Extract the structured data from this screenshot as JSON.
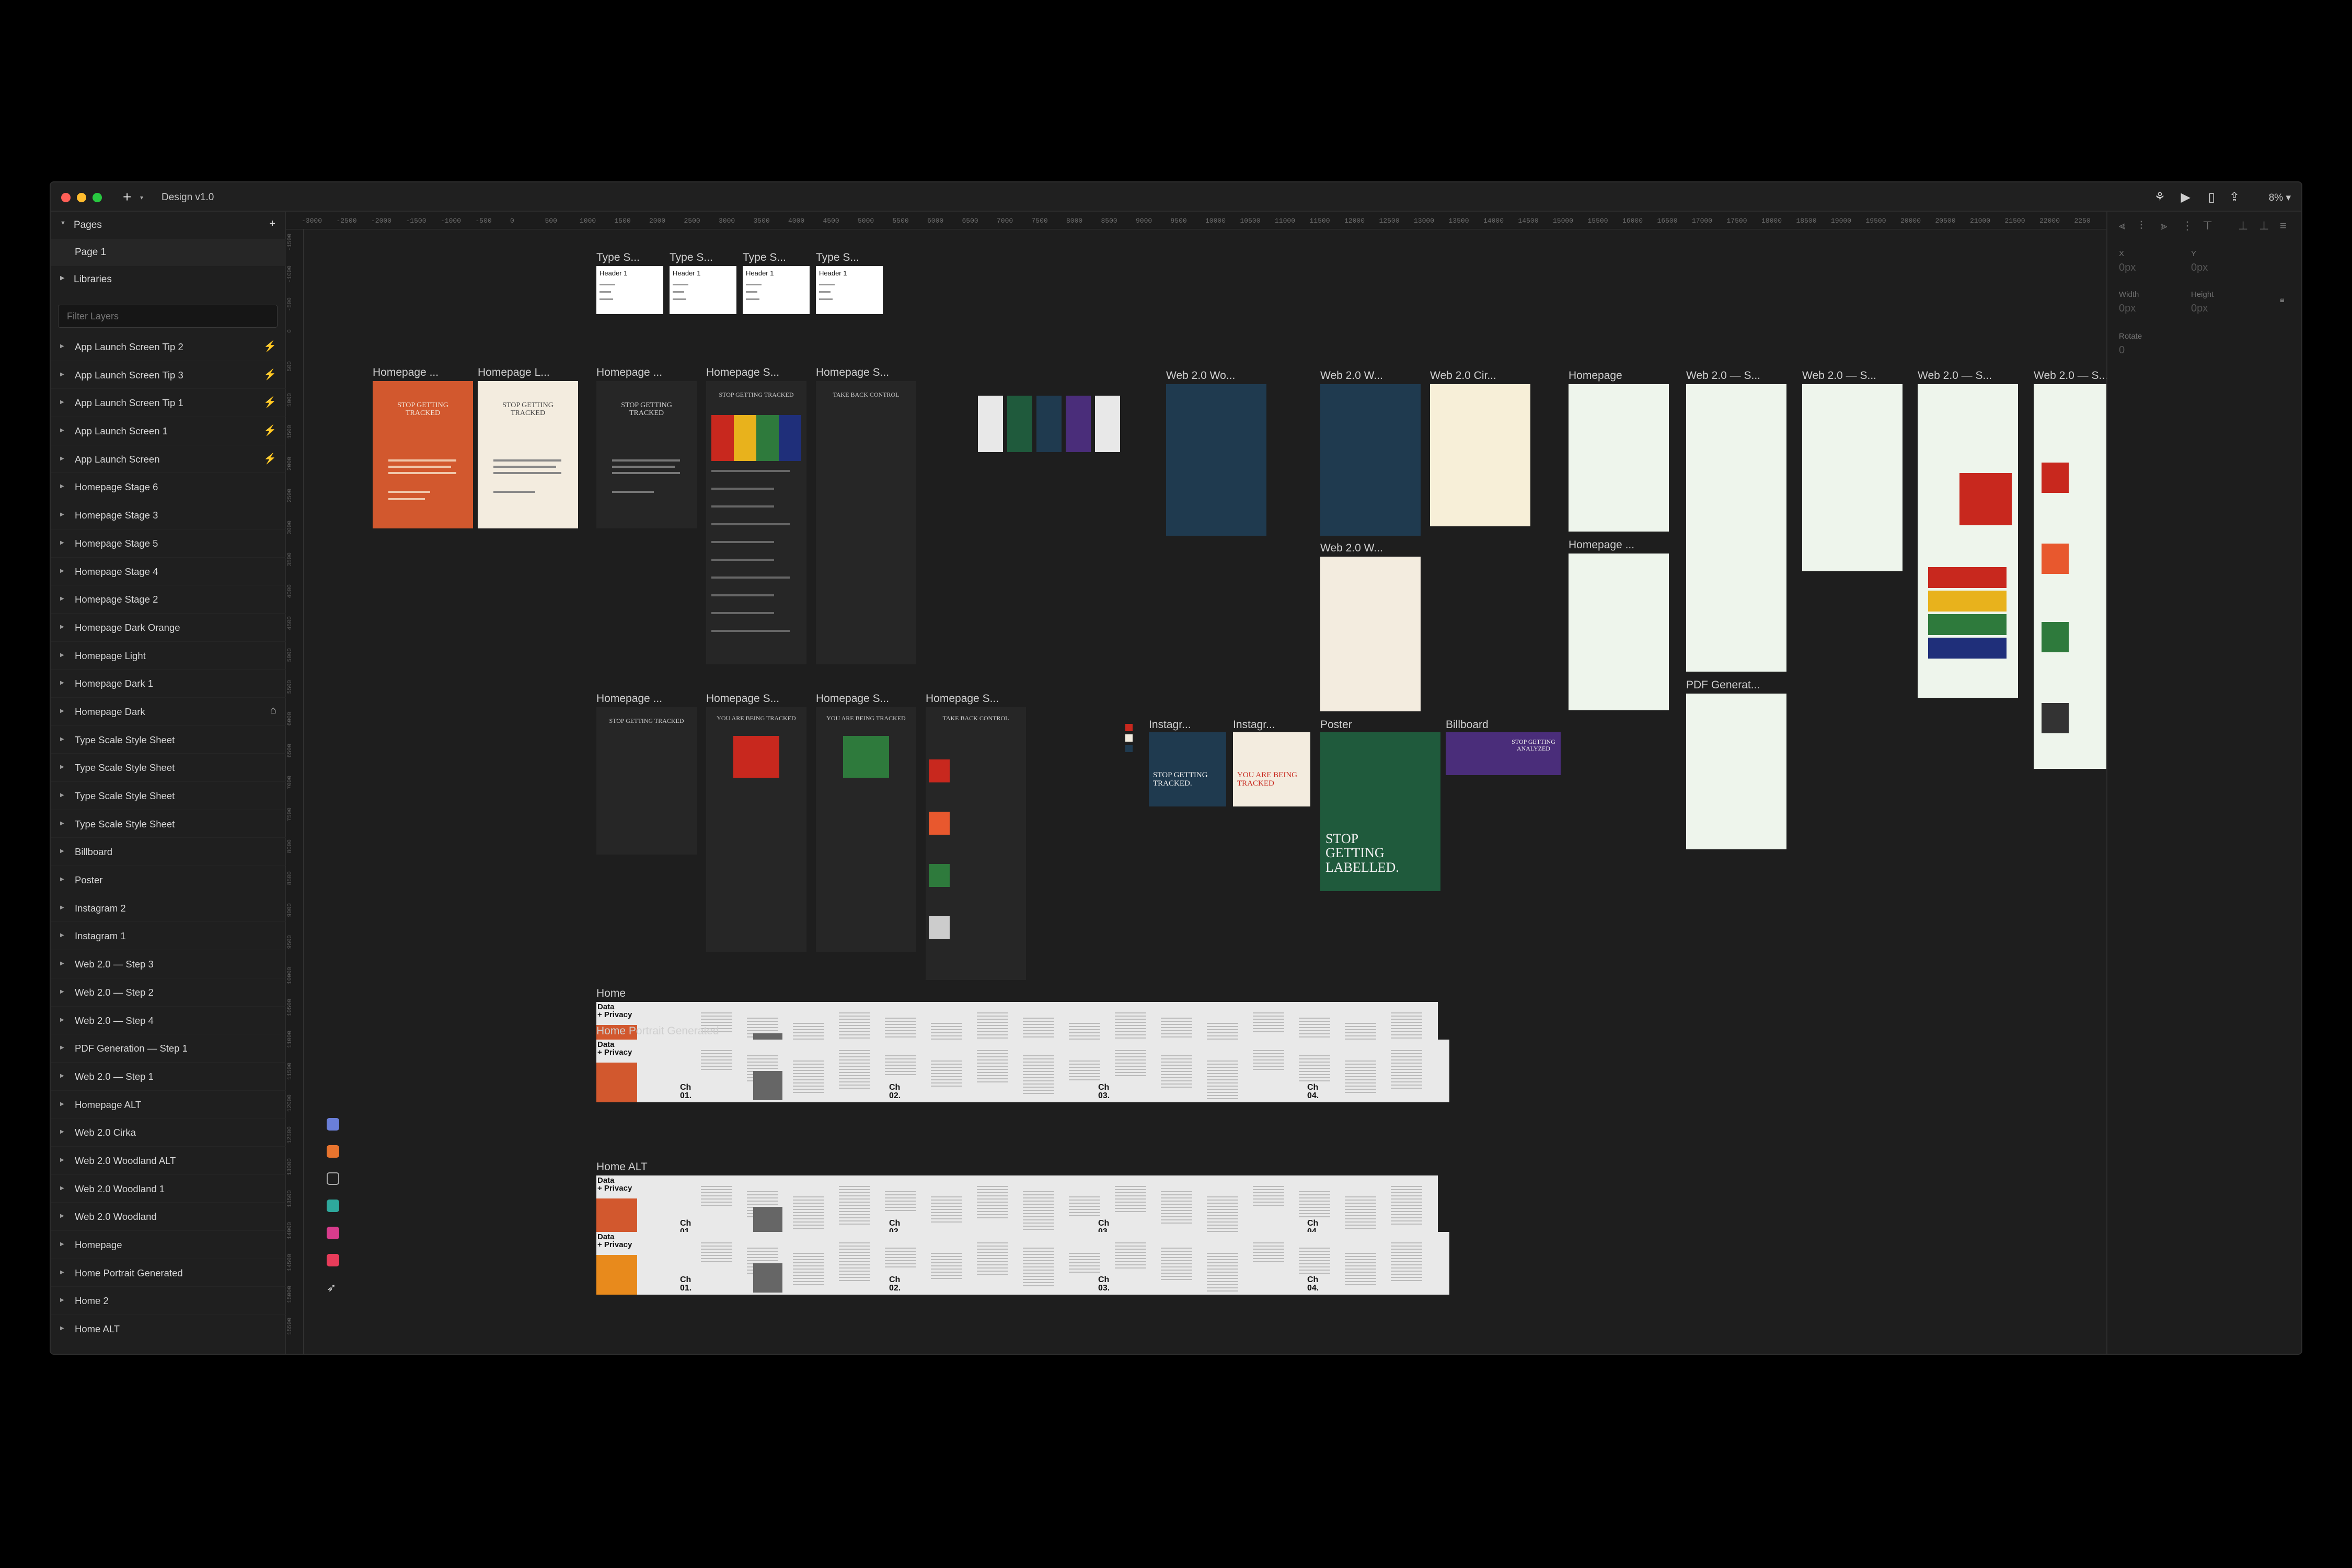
{
  "window": {
    "doc_title": "Design v1.0",
    "zoom": "8%"
  },
  "colors": {
    "canvas": "#1e1e1e",
    "orange": "#d2582e",
    "cream": "#f3ecdf",
    "navy": "#1f3a4f",
    "green": "#1f5a3c",
    "purple": "#4a2d7a",
    "mint": "#eef5ec",
    "red": "#c8281e",
    "yellow": "#e8b21c"
  },
  "sidebar": {
    "pages_label": "Pages",
    "pages": [
      "Page 1"
    ],
    "libraries_label": "Libraries",
    "filter_placeholder": "Filter Layers",
    "layers": [
      "App Launch Screen Tip 2",
      "App Launch Screen Tip 3",
      "App Launch Screen Tip 1",
      "App Launch Screen 1",
      "App Launch Screen",
      "Homepage Stage 6",
      "Homepage Stage 3",
      "Homepage Stage 5",
      "Homepage Stage 4",
      "Homepage Stage 2",
      "Homepage Dark Orange",
      "Homepage Light",
      "Homepage Dark 1",
      "Homepage Dark",
      "Type Scale Style Sheet",
      "Type Scale Style Sheet",
      "Type Scale Style Sheet",
      "Type Scale Style Sheet",
      "Billboard",
      "Poster",
      "Instagram 2",
      "Instagram 1",
      "Web 2.0 — Step 3",
      "Web 2.0 — Step 2",
      "Web 2.0 — Step 4",
      "PDF Generation — Step 1",
      "Web 2.0 — Step 1",
      "Homepage ALT",
      "Web 2.0 Cirka",
      "Web 2.0 Woodland ALT",
      "Web 2.0 Woodland 1",
      "Web 2.0 Woodland",
      "Homepage",
      "Home Portrait Generated",
      "Home 2",
      "Home ALT"
    ]
  },
  "ruler": {
    "top": [
      "-3000",
      "-2500",
      "-2000",
      "-1500",
      "-1000",
      "-500",
      "0",
      "500",
      "1000",
      "1500",
      "2000",
      "2500",
      "3000",
      "3500",
      "4000",
      "4500",
      "5000",
      "5500",
      "6000",
      "6500",
      "7000",
      "7500",
      "8000",
      "8500",
      "9000",
      "9500",
      "10000",
      "10500",
      "11000",
      "11500",
      "12000",
      "12500",
      "13000",
      "13500",
      "14000",
      "14500",
      "15000",
      "15500",
      "16000",
      "16500",
      "17000",
      "17500",
      "18000",
      "18500",
      "19000",
      "19500",
      "20000",
      "20500",
      "21000",
      "21500",
      "22000",
      "2250"
    ],
    "left": [
      "-1500",
      "-1000",
      "-500",
      "0",
      "500",
      "1000",
      "1500",
      "2000",
      "2500",
      "3000",
      "3500",
      "4000",
      "4500",
      "5000",
      "5500",
      "6000",
      "6500",
      "7000",
      "7500",
      "8000",
      "8500",
      "9000",
      "9500",
      "10000",
      "10500",
      "11000",
      "11500",
      "12000",
      "12500",
      "13000",
      "13500",
      "14000",
      "14500",
      "15000",
      "15500"
    ]
  },
  "rightpanel": {
    "x": "X",
    "y": "Y",
    "width": "Width",
    "height": "Height",
    "rotate": "Rotate",
    "xv": "0px",
    "yv": "0px",
    "wv": "0px",
    "hv": "0px",
    "rv": "0"
  },
  "frames": {
    "type_titles": [
      "Type S...",
      "Type S...",
      "Type S...",
      "Type S..."
    ],
    "type_header": "Header 1",
    "launch": [
      "Homepage ...",
      "Homepage L...",
      "Homepage ...",
      "Homepage S...",
      "Homepage S..."
    ],
    "stop_getting_tracked": "STOP GETTING TRACKED",
    "take_back": "TAKE BACK CONTROL",
    "being_tracked": "YOU ARE BEING TRACKED",
    "row2": [
      "Homepage ...",
      "Homepage S...",
      "Homepage S...",
      "Homepage S..."
    ],
    "web": [
      "Web 2.0 Wo...",
      "Web 2.0 W...",
      "Web 2.0 Cir...",
      "Homepage",
      "Web 2.0 — S...",
      "Web 2.0 — S...",
      "Web 2.0 — S...",
      "Web 2.0 — S..."
    ],
    "web_row2": [
      "Web 2.0 W...",
      "Homepage ...",
      "PDF Generat..."
    ],
    "social": [
      "Instagr...",
      "Instagr...",
      "Poster",
      "Billboard"
    ],
    "insta_navy": "STOP GETTING TRACKED.",
    "insta_cream": "YOU ARE BEING TRACKED",
    "poster_text": "STOP GETTING LABELLED.",
    "billboard_text": "STOP GETTING ANALYZED",
    "long": [
      "Home",
      "Home Portrait Generated",
      "Home ALT"
    ],
    "data_privacy": "Data\n+ Privacy",
    "chapters": [
      "Ch 01.",
      "Ch 02.",
      "Ch 03.",
      "Ch 04."
    ]
  }
}
